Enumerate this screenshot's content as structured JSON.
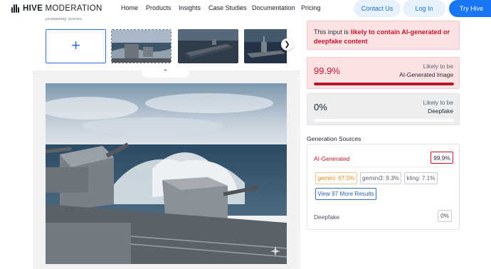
{
  "brand": {
    "name_bold": "HIVE",
    "name_rest": " MODERATION"
  },
  "nav": [
    "Home",
    "Products",
    "Insights",
    "Case Studies",
    "Documentation",
    "Pricing"
  ],
  "header_buttons": {
    "contact": "Contact Us",
    "login": "Log In",
    "try": "Try Hive"
  },
  "upload": {
    "cut_text": "probability scores."
  },
  "warning": {
    "prefix": "This input is ",
    "strong": "likely to contain AI-generated or deepfake content"
  },
  "scores": [
    {
      "value": "99.9%",
      "label_top": "Likely to be",
      "label_main": "AI-Generated Image",
      "progress": 0.999
    },
    {
      "value": "0%",
      "label_top": "Likely to be",
      "label_main": "Deepfake",
      "progress": 0
    }
  ],
  "generation": {
    "title": "Generation Sources",
    "ai_label": "AI-Generated",
    "ai_value": "99.9%",
    "chips": [
      "gemini: 67.5%",
      "gemini3: 9.3%",
      "kling: 7.1%"
    ],
    "more": "View 97 More Results",
    "deepfake_label": "Deepfake",
    "deepfake_value": "0%"
  },
  "colors": {
    "accent": "#1877f2",
    "alert": "#c4142b",
    "alert_bg": "#fde2e4"
  }
}
